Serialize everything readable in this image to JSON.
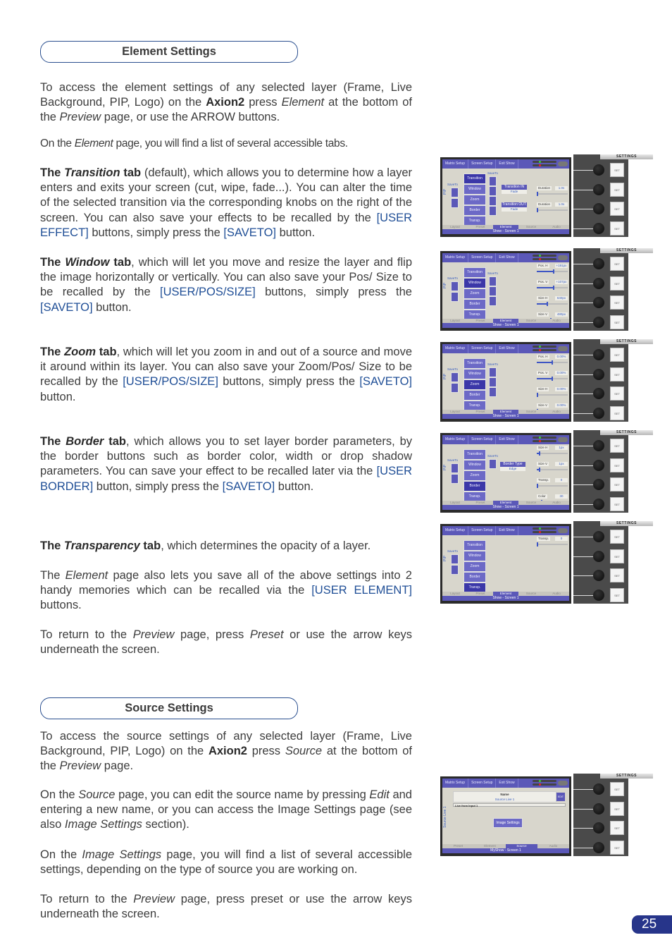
{
  "element_settings": {
    "heading": "Element Settings",
    "intro": {
      "p1": "To access the element settings of any selected layer (Frame, Live Background, PIP, Logo)  on the ",
      "brand": "Axion2",
      "p2": " press ",
      "em1": "Element",
      "p3": " at the bottom of the ",
      "em2": "Preview",
      "p4": " page, or use the ARROW buttons."
    },
    "tabs_intro": {
      "p1": "On the ",
      "em": "Element",
      "p2": " page, you will find a list of several accessible tabs."
    },
    "transition": {
      "b1": "The ",
      "bi": "Transition",
      "b2": " tab",
      "t1": " (default), which allows you to determine how a layer enters and exits your screen (cut, wipe, fade...). You can alter the time of the selected transition via the corresponding knobs on the right of the screen. You can also save your effects to be recalled by the ",
      "link1": "[USER EFFECT]",
      "t2": " buttons, simply press the ",
      "link2": "[SAVETO]",
      "t3": " button."
    },
    "window": {
      "b1": "The ",
      "bi": "Window",
      "b2": " tab",
      "t1": ", which will let you move and resize the layer and flip the image horizontally or vertically. You can also save your Pos/ Size to be recalled by the ",
      "link1": "[USER/POS/SIZE]",
      "t2": " buttons, simply press the ",
      "link2": "[SAVETO]",
      "t3": " button."
    },
    "zoom": {
      "b1": "The ",
      "bi": "Zoom",
      "b2": " tab",
      "t1": ", which will let you zoom in and out of a source and move it around within its layer. You can also save your Zoom/Pos/ Size to be recalled by the ",
      "link1": "[USER/POS/SIZE]",
      "t2": " buttons, simply press the ",
      "link2": "[SAVETO]",
      "t3": " button."
    },
    "border": {
      "b1": "The ",
      "bi": "Border",
      "b2": " tab",
      "t1": ", which allows you to set layer border parameters, by the border buttons such as border color, width or drop shadow parameters. You can save your effect to be recalled later via the ",
      "link1": "[USER BORDER]",
      "t2": " button, simply press the ",
      "link2": "[SAVETO]",
      "t3": " button."
    },
    "transparency": {
      "b1": "The ",
      "bi": "Transparency",
      "b2": " tab",
      "t1": ", which determines the opacity of a layer."
    },
    "memories": {
      "t1": "The ",
      "em": "Element",
      "t2": " page also lets you save all of the above settings into 2 handy memories which can be recalled via the ",
      "link": "[USER ELEMENT]",
      "t3": " buttons."
    },
    "return": {
      "t1": "To return to the ",
      "em1": "Preview",
      "t2": " page, press ",
      "em2": "Preset",
      "t3": " or use the arrow keys underneath the screen."
    }
  },
  "source_settings": {
    "heading": "Source Settings",
    "intro": {
      "p1": "To access the source settings of any selected layer (Frame, Live Background, PIP, Logo)  on the ",
      "brand": "Axion2",
      "p2": " press ",
      "em1": "Source",
      "p3": "  at the bottom of the ",
      "em2": "Preview",
      "p4": " page."
    },
    "edit": {
      "t1": "On the ",
      "em1": "Source",
      "t2": " page, you can edit the source name by pressing ",
      "em2": "Edit",
      "t3": " and entering a new name, or you can access the Image Settings page (see also ",
      "em3": "Image Settings",
      "t4": " section)."
    },
    "image": {
      "t1": "On the ",
      "em": "Image Settings",
      "t2": " page, you will find a list of several accessible settings, depending on the type of source you are working on."
    },
    "return": {
      "t1": "To return to the ",
      "em": "Preview",
      "t2": " page, press preset or use the arrow keys underneath the screen."
    }
  },
  "device": {
    "top_buttons": [
      "Matrix Setup",
      "Screen Setup",
      "Exit Show"
    ],
    "side_label": "PIP",
    "saveto_label": "SaveTo",
    "tabs": [
      "Transition",
      "Window",
      "Zoom",
      "Border",
      "Transp."
    ],
    "bottom_tabs": [
      "Layout",
      "Preset",
      "Element",
      "Source",
      "Audio"
    ],
    "status": "Show - Screen 1",
    "panel_label": "SETTINGS",
    "set_label": "SET",
    "transition": {
      "in_label": "Transition IN",
      "in_value": "Fade",
      "out_label": "Transition OUT",
      "out_value": "Fade",
      "params": [
        {
          "label": "Duration",
          "value": "1.0s",
          "level": 0.02
        },
        {
          "label": "Duration",
          "value": "1.0s",
          "level": 0.02
        }
      ]
    },
    "window": {
      "params": [
        {
          "label": "Pos. H",
          "value": "+191px",
          "level": 0.55
        },
        {
          "label": "Pos. V",
          "value": "+107px",
          "level": 0.55
        },
        {
          "label": "Size H",
          "value": "640px",
          "level": 0.35
        },
        {
          "label": "Size V",
          "value": "480px",
          "level": 0.45
        }
      ]
    },
    "zoom": {
      "params": [
        {
          "label": "Pos. H",
          "value": "0.00%",
          "level": 0.5
        },
        {
          "label": "Pos. V",
          "value": "0.00%",
          "level": 0.5
        },
        {
          "label": "Size H",
          "value": "0.00%",
          "level": 0.0
        },
        {
          "label": "Size V",
          "value": "0.00%",
          "level": 0.0
        }
      ]
    },
    "border": {
      "type_label": "Border Type",
      "type_value": "Edge",
      "params": [
        {
          "label": "Size H",
          "value": "1px",
          "level": 0.1
        },
        {
          "label": "Size V",
          "value": "1px",
          "level": 0.1
        },
        {
          "label": "Transp.",
          "value": "0",
          "level": 0.0
        },
        {
          "label": "Color",
          "value": "30",
          "level": 0.15
        }
      ]
    },
    "transp": {
      "params": [
        {
          "label": "Transp.",
          "value": "0",
          "level": 0.0
        }
      ]
    },
    "source": {
      "side_label": "Source Live 1",
      "name_label": "Name",
      "name_value": "Source Live 1",
      "edit_label": "EDIT",
      "live_label": "Live from Input 1",
      "image_settings": "Image Settings",
      "bottom_tabs": [
        "Preset",
        "Element",
        "Source",
        "Audio"
      ],
      "status": "MyShow - Screen 1"
    }
  },
  "page_number": "25"
}
